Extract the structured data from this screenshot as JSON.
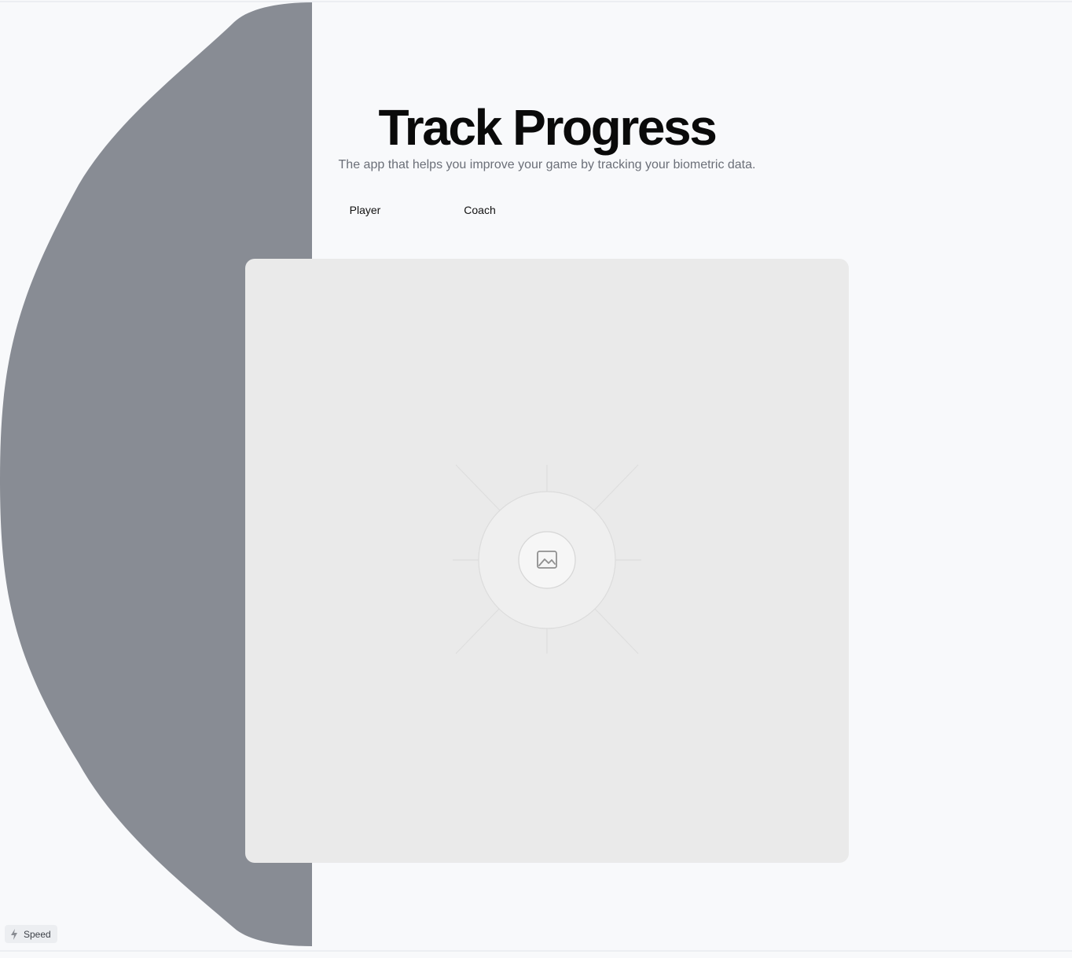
{
  "hero": {
    "title": "Track Progress",
    "subtitle": "The app that helps you improve your game by tracking your biometric data."
  },
  "tabs": [
    {
      "label": "Player"
    },
    {
      "label": "Coach"
    }
  ],
  "media": {
    "state": "image placeholder",
    "icon": "image-icon"
  },
  "badge": {
    "icon": "lightning-icon",
    "label": "Speed"
  },
  "colors": {
    "background": "#f8f9fb",
    "blob": "#888c94",
    "media_background": "#eaeaea",
    "title": "#0a0a0a",
    "subtitle": "#6b6f78"
  }
}
